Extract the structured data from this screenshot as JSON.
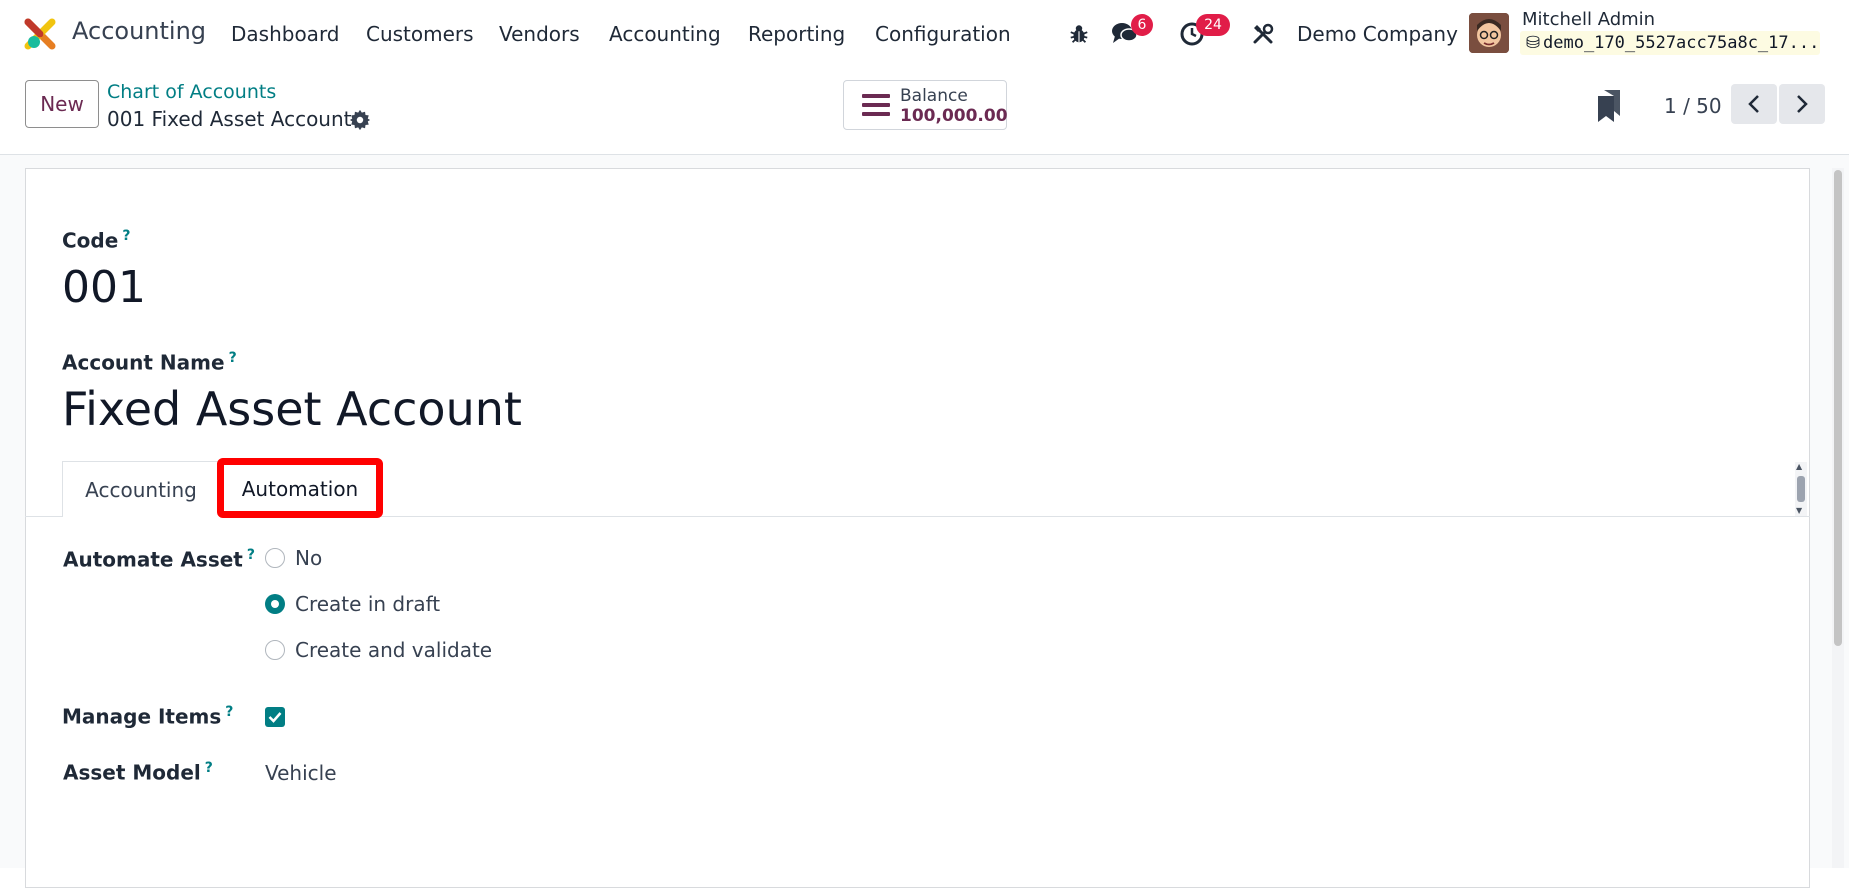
{
  "navbar": {
    "app_name": "Accounting",
    "menu": [
      "Dashboard",
      "Customers",
      "Vendors",
      "Accounting",
      "Reporting",
      "Configuration"
    ],
    "messages_count": "6",
    "activities_count": "24",
    "company": "Demo Company",
    "user_name": "Mitchell Admin",
    "database": "demo_170_5527acc75a8c_17..."
  },
  "control_panel": {
    "new_label": "New",
    "breadcrumb_parent": "Chart of Accounts",
    "breadcrumb_current": "001 Fixed Asset Account",
    "smart_button": {
      "label": "Balance",
      "value": "100,000.00"
    },
    "pager": "1 / 50"
  },
  "form": {
    "code_label": "Code",
    "code_value": "001",
    "name_label": "Account Name",
    "name_value": "Fixed Asset Account",
    "help_mark": "?",
    "tabs": [
      {
        "label": "Accounting",
        "active": false
      },
      {
        "label": "Automation",
        "active": true
      }
    ],
    "automate_asset": {
      "label": "Automate Asset",
      "options": [
        "No",
        "Create in draft",
        "Create and validate"
      ],
      "selected": "Create in draft"
    },
    "manage_items": {
      "label": "Manage Items",
      "checked": true
    },
    "asset_model": {
      "label": "Asset Model",
      "value": "Vehicle"
    }
  },
  "colors": {
    "brand": "#6b2a52",
    "accent": "#017e84",
    "badge": "#e11d48",
    "highlight": "#ff0000"
  }
}
